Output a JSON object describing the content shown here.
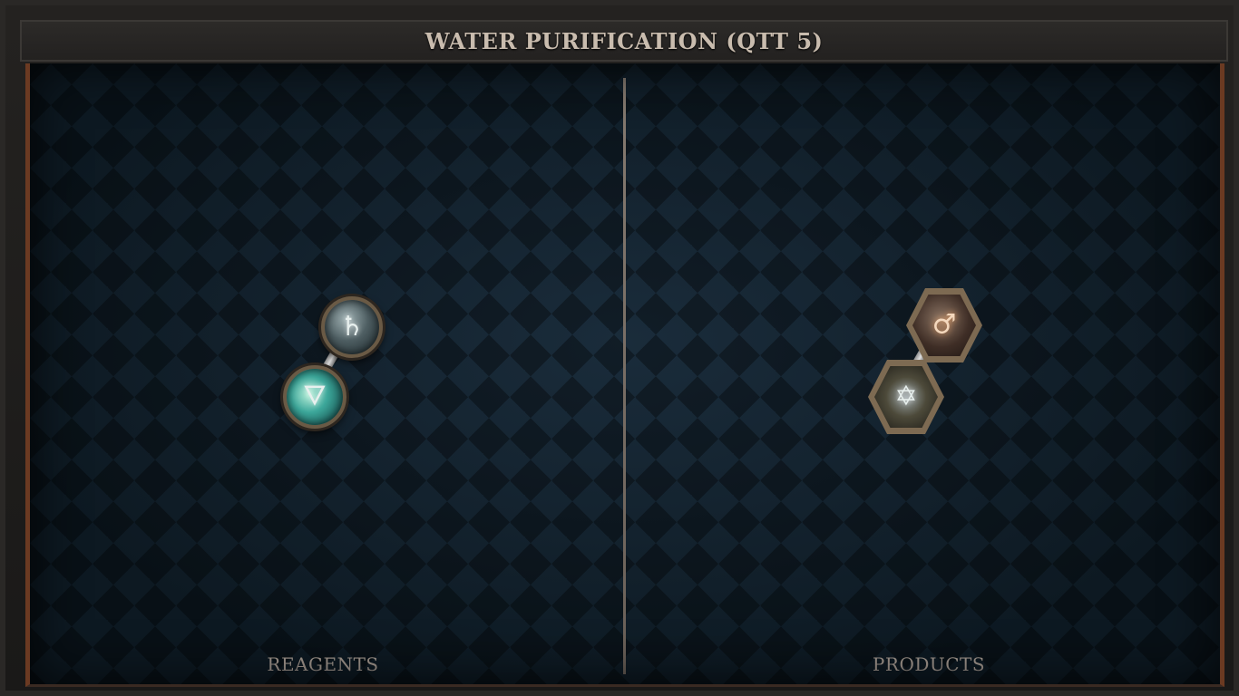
{
  "title": "WATER PURIFICATION (QTT 5)",
  "panels": {
    "left_label": "REAGENTS",
    "right_label": "PRODUCTS"
  },
  "reagents": [
    {
      "icon": "saturn-symbol-icon",
      "glyph": "♄",
      "shape": "round"
    },
    {
      "icon": "water-element-icon",
      "glyph": "🜄",
      "shape": "round"
    }
  ],
  "products": [
    {
      "icon": "mars-symbol-icon",
      "glyph": "♂",
      "shape": "hexagon"
    },
    {
      "icon": "hexagram-star-icon",
      "glyph": "✡",
      "shape": "hexagon"
    }
  ],
  "colors": {
    "border_accent": "#6b3a22",
    "board_bg": "#0f1c27",
    "title_text": "#c9bcae"
  }
}
